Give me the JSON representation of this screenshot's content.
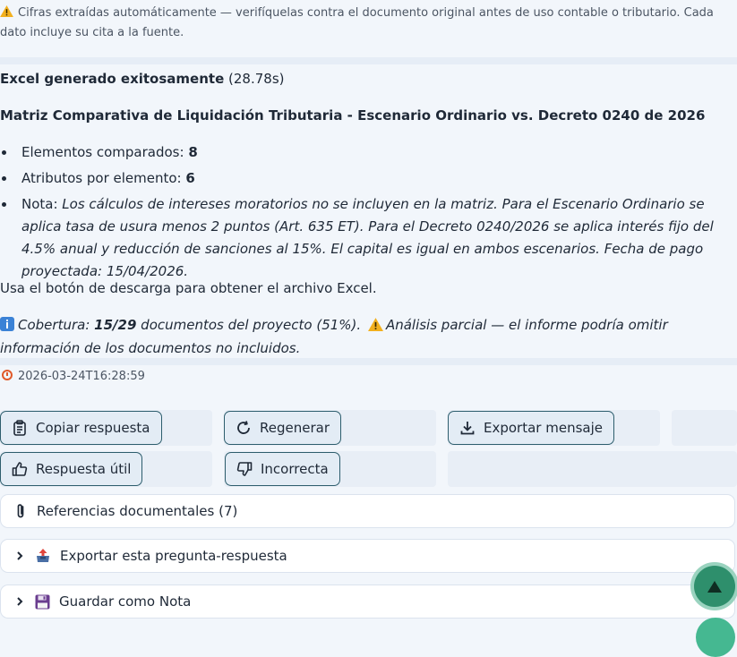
{
  "warning_banner": {
    "icon": "warning-icon",
    "text": "Cifras extraídas automáticamente — verifíquelas contra el documento original antes de uso contable o tributario. Cada dato incluye su cita a la fuente."
  },
  "message": {
    "success_label": "Excel generado exitosamente",
    "duration": "(28.78s)",
    "title": "Matriz Comparativa de Liquidación Tributaria - Escenario Ordinario vs. Decreto 0240 de 2026",
    "bullets": [
      {
        "label": "Elementos comparados: ",
        "value": "8"
      },
      {
        "label": "Atributos por elemento: ",
        "value": "6"
      },
      {
        "label": "Nota: ",
        "value": "Los cálculos de intereses moratorios no se incluyen en la matriz. Para el Escenario Ordinario se aplica tasa de usura menos 2 puntos (Art. 635 ET). Para el Decreto 0240/2026 se aplica interés fijo del 4.5% anual y reducción de sanciones al 15%. El capital es igual en ambos escenarios. Fecha de pago proyectada: 15/04/2026."
      }
    ],
    "download_hint": "Usa el botón de descarga para obtener el archivo Excel.",
    "coverage": {
      "label": "Cobertura:",
      "fraction": "15/29",
      "text": "documentos del proyecto (51%).",
      "partial": "Análisis parcial — el informe podría omitir información de los documentos no incluidos."
    },
    "timestamp": "2026-03-24T16:28:59"
  },
  "actions": {
    "copy": "Copiar respuesta",
    "regenerate": "Regenerar",
    "export_message": "Exportar mensaje",
    "useful": "Respuesta útil",
    "incorrect": "Incorrecta"
  },
  "panels": {
    "references": "Referencias documentales (7)",
    "export_qa": "Exportar esta pregunta-respuesta",
    "save_note": "Guardar como Nota"
  },
  "colors": {
    "accent": "#2d5d6d",
    "fab": "#2e8f6c",
    "warning": "#f2b01e"
  }
}
